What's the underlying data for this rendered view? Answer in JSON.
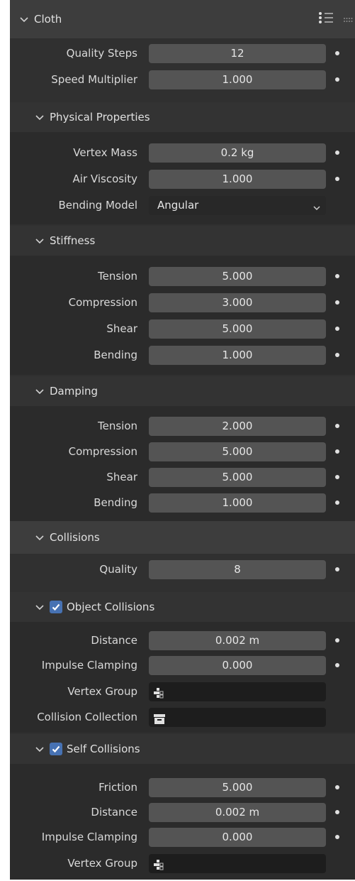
{
  "cloth": {
    "title": "Cloth"
  },
  "general": [
    {
      "label": "Quality Steps",
      "value": "12"
    },
    {
      "label": "Speed Multiplier",
      "value": "1.000"
    }
  ],
  "physical": {
    "title": "Physical Properties",
    "rows": [
      {
        "label": "Vertex Mass",
        "value": "0.2 kg"
      },
      {
        "label": "Air Viscosity",
        "value": "1.000"
      }
    ],
    "bending_model": {
      "label": "Bending Model",
      "value": "Angular"
    }
  },
  "stiffness": {
    "title": "Stiffness",
    "rows": [
      {
        "label": "Tension",
        "value": "5.000"
      },
      {
        "label": "Compression",
        "value": "3.000"
      },
      {
        "label": "Shear",
        "value": "5.000"
      },
      {
        "label": "Bending",
        "value": "1.000"
      }
    ]
  },
  "damping": {
    "title": "Damping",
    "rows": [
      {
        "label": "Tension",
        "value": "2.000"
      },
      {
        "label": "Compression",
        "value": "5.000"
      },
      {
        "label": "Shear",
        "value": "5.000"
      },
      {
        "label": "Bending",
        "value": "1.000"
      }
    ]
  },
  "collisions": {
    "title": "Collisions",
    "quality": {
      "label": "Quality",
      "value": "8"
    }
  },
  "object_collisions": {
    "title": "Object Collisions",
    "enabled": true,
    "rows": [
      {
        "label": "Distance",
        "value": "0.002 m"
      },
      {
        "label": "Impulse Clamping",
        "value": "0.000"
      }
    ],
    "vertex_group": {
      "label": "Vertex Group",
      "value": ""
    },
    "collision_collection": {
      "label": "Collision Collection",
      "value": ""
    }
  },
  "self_collisions": {
    "title": "Self Collisions",
    "enabled": true,
    "rows": [
      {
        "label": "Friction",
        "value": "5.000"
      },
      {
        "label": "Distance",
        "value": "0.002 m"
      },
      {
        "label": "Impulse Clamping",
        "value": "0.000"
      }
    ],
    "vertex_group": {
      "label": "Vertex Group",
      "value": ""
    }
  },
  "colors": {
    "panel_bg": "#303030",
    "header_bg": "#3d3d3d",
    "field_bg": "#545454",
    "checkbox": "#4772b3"
  }
}
